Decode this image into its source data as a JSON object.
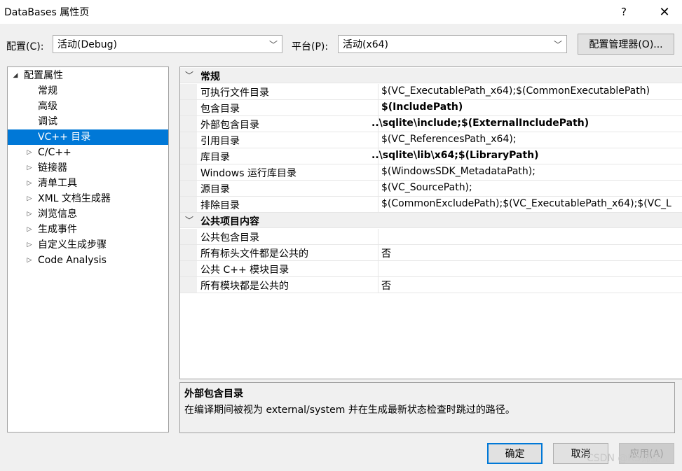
{
  "window": {
    "title": "DataBases 属性页",
    "help_glyph": "?",
    "close_glyph": "✕"
  },
  "toolbar": {
    "config_label": "配置(C):",
    "config_value": "活动(Debug)",
    "platform_label": "平台(P):",
    "platform_value": "活动(x64)",
    "config_manager_label": "配置管理器(O)...",
    "dropdown_arrow": "﹀"
  },
  "tree": {
    "items": [
      {
        "label": "配置属性",
        "expander": "◢"
      },
      {
        "label": "常规",
        "expander": ""
      },
      {
        "label": "高级",
        "expander": ""
      },
      {
        "label": "调试",
        "expander": ""
      },
      {
        "label": "VC++ 目录",
        "expander": ""
      },
      {
        "label": "C/C++",
        "expander": "▷"
      },
      {
        "label": "链接器",
        "expander": "▷"
      },
      {
        "label": "清单工具",
        "expander": "▷"
      },
      {
        "label": "XML 文档生成器",
        "expander": "▷"
      },
      {
        "label": "浏览信息",
        "expander": "▷"
      },
      {
        "label": "生成事件",
        "expander": "▷"
      },
      {
        "label": "自定义生成步骤",
        "expander": "▷"
      },
      {
        "label": "Code Analysis",
        "expander": "▷"
      }
    ]
  },
  "grid": {
    "categories": [
      {
        "label": "常规",
        "chevron": "﹀",
        "properties": [
          {
            "name": "可执行文件目录",
            "value": "$(VC_ExecutablePath_x64);$(CommonExecutablePath)",
            "bold": false
          },
          {
            "name": "包含目录",
            "value": "$(IncludePath)",
            "bold": true
          },
          {
            "name": "外部包含目录",
            "value": "..\\sqlite\\include;$(ExternalIncludePath)",
            "bold": true
          },
          {
            "name": "引用目录",
            "value": "$(VC_ReferencesPath_x64);",
            "bold": false
          },
          {
            "name": "库目录",
            "value": "..\\sqlite\\lib\\x64;$(LibraryPath)",
            "bold": true
          },
          {
            "name": "Windows 运行库目录",
            "value": "$(WindowsSDK_MetadataPath);",
            "bold": false
          },
          {
            "name": "源目录",
            "value": "$(VC_SourcePath);",
            "bold": false
          },
          {
            "name": "排除目录",
            "value": "$(CommonExcludePath);$(VC_ExecutablePath_x64);$(VC_L",
            "bold": false
          }
        ]
      },
      {
        "label": "公共项目内容",
        "chevron": "﹀",
        "properties": [
          {
            "name": "公共包含目录",
            "value": "",
            "bold": false
          },
          {
            "name": "所有标头文件都是公共的",
            "value": "否",
            "bold": false
          },
          {
            "name": "公共 C++ 模块目录",
            "value": "",
            "bold": false
          },
          {
            "name": "所有模块都是公共的",
            "value": "否",
            "bold": false
          }
        ]
      }
    ]
  },
  "description": {
    "title": "外部包含目录",
    "text": "在编译期间被视为 external/system 并在生成最新状态检查时跳过的路径。"
  },
  "buttons": {
    "ok": "确定",
    "cancel": "取消",
    "apply": "应用(A)"
  },
  "watermark": "CSDN @RS锦立"
}
